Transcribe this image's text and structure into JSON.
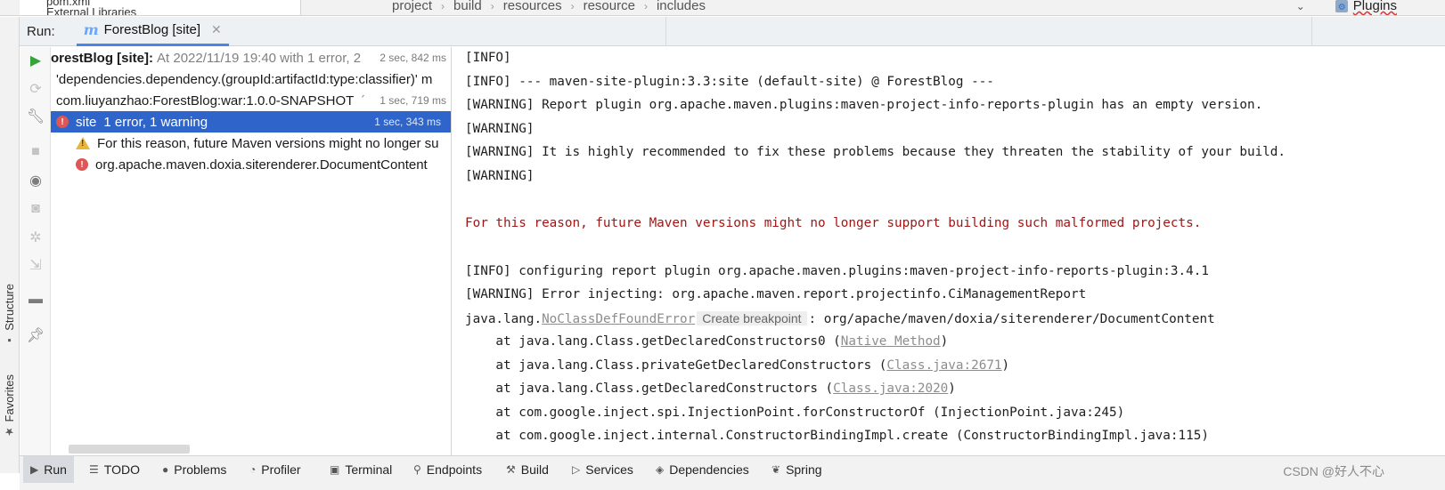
{
  "top": {
    "tree_stub_1": "pom.xml",
    "tree_stub_2": "External Libraries",
    "breadcrumb": [
      "project",
      "build",
      "resources",
      "resource",
      "includes"
    ],
    "plugins_label": "Plugins"
  },
  "run": {
    "label": "Run:",
    "tab_title": "ForestBlog [site]"
  },
  "side_labels": {
    "structure": "Structure",
    "favorites": "Favorites"
  },
  "tree": [
    {
      "main": "orestBlog [site]:",
      "meta": "At 2022/11/19 19:40 with 1 error, 2",
      "time": "2 sec, 842 ms",
      "bold": true
    },
    {
      "main": "'dependencies.dependency.(groupId:artifactId:type:classifier)' m",
      "time": ""
    },
    {
      "main": "com.liuyanzhao:ForestBlog:war:1.0.0-SNAPSHOT",
      "meta": "´",
      "time": "1 sec, 719 ms"
    },
    {
      "main": "site",
      "meta": "1 error, 1 warning",
      "time": "1 sec, 343 ms",
      "selected": true
    },
    {
      "main": "For this reason, future Maven versions might no longer su",
      "time": ""
    },
    {
      "main": "org.apache.maven.doxia.siterenderer.DocumentContent",
      "time": ""
    }
  ],
  "console": {
    "l1": "[INFO]",
    "l2": "[INFO] --- maven-site-plugin:3.3:site (default-site) @ ForestBlog ---",
    "l3": "[WARNING] Report plugin org.apache.maven.plugins:maven-project-info-reports-plugin has an empty version.",
    "l4": "[WARNING]",
    "l5": "[WARNING] It is highly recommended to fix these problems because they threaten the stability of your build.",
    "l6": "[WARNING]",
    "l7": "For this reason, future Maven versions might no longer support building such malformed projects.",
    "l8": "[INFO] configuring report plugin org.apache.maven.plugins:maven-project-info-reports-plugin:3.4.1",
    "l9": "[WARNING] Error injecting: org.apache.maven.report.projectinfo.CiManagementReport",
    "l10_pre": "java.lang.",
    "l10_link": "NoClassDefFoundError",
    "l10_hint": "Create breakpoint",
    "l10_post": ": org/apache/maven/doxia/siterenderer/DocumentContent",
    "l11_pre": "    at java.lang.Class.getDeclaredConstructors0 (",
    "l11_link": "Native Method",
    "l11_post": ")",
    "l12_pre": "    at java.lang.Class.privateGetDeclaredConstructors (",
    "l12_link": "Class.java:2671",
    "l12_post": ")",
    "l13_pre": "    at java.lang.Class.getDeclaredConstructors (",
    "l13_link": "Class.java:2020",
    "l13_post": ")",
    "l14": "    at com.google.inject.spi.InjectionPoint.forConstructorOf (InjectionPoint.java:245)",
    "l15": "    at com.google.inject.internal.ConstructorBindingImpl.create (ConstructorBindingImpl.java:115)"
  },
  "bottom": {
    "items": [
      "Run",
      "TODO",
      "Problems",
      "Profiler",
      "Terminal",
      "Endpoints",
      "Build",
      "Services",
      "Dependencies",
      "Spring"
    ],
    "watermark": "CSDN @好人不心"
  },
  "colors": {
    "accent": "#2f65ca",
    "error_text": "#a31515",
    "run_green": "#37a33c"
  }
}
